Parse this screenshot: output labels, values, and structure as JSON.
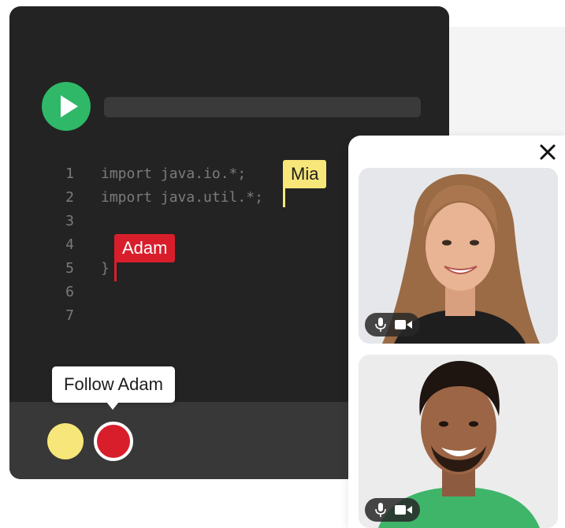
{
  "editor": {
    "lines": [
      {
        "num": "1",
        "code": "import java.io.*;"
      },
      {
        "num": "2",
        "code": "import java.util.*;"
      },
      {
        "num": "3",
        "code": ""
      },
      {
        "num": "4",
        "code": ""
      },
      {
        "num": "5",
        "code": "}"
      },
      {
        "num": "6",
        "code": ""
      },
      {
        "num": "7",
        "code": ""
      }
    ],
    "cursors": {
      "mia": {
        "label": "Mia",
        "color": "#f7e679"
      },
      "adam": {
        "label": "Adam",
        "color": "#d81e2b"
      }
    }
  },
  "footer": {
    "tooltip": "Follow Adam"
  },
  "icons": {
    "run": "play-icon",
    "close": "close-icon",
    "mic": "microphone-icon",
    "camera": "video-camera-icon"
  },
  "colors": {
    "run_green": "#2fb868",
    "editor_bg": "#232323"
  }
}
